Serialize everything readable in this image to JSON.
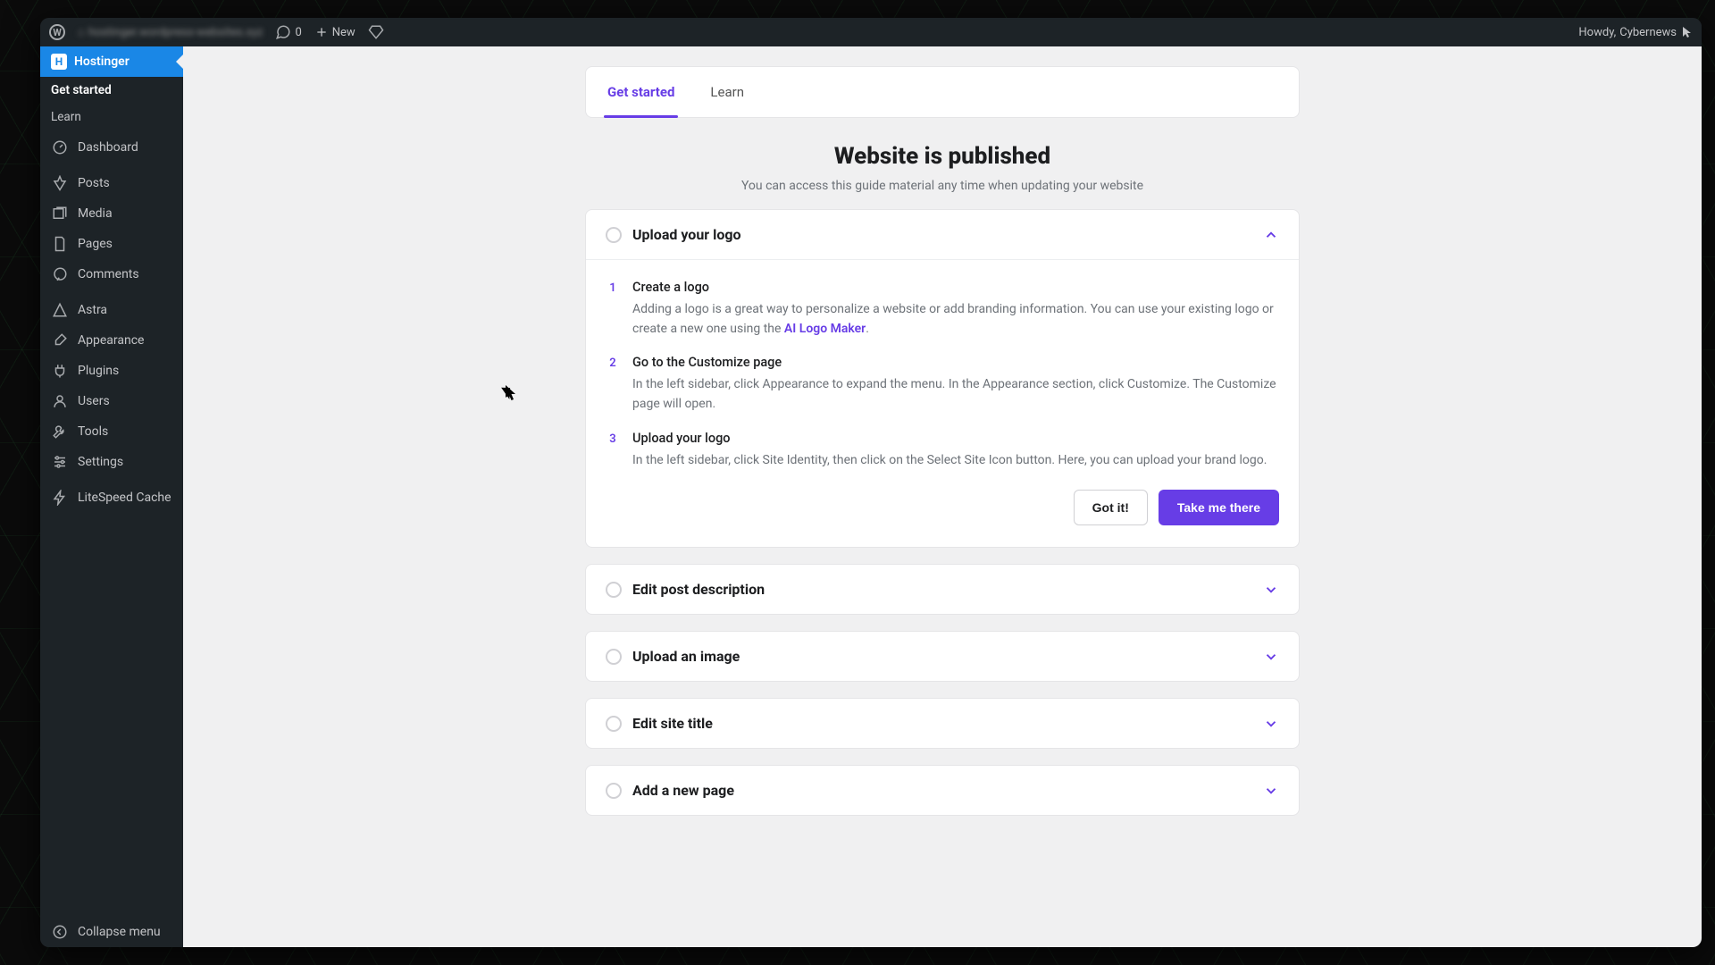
{
  "adminbar": {
    "site_name_blur": "hostinger.wordpress-websites.xyz",
    "comments_count": "0",
    "new_label": "New",
    "howdy_prefix": "Howdy, ",
    "user_name": "Cybernews"
  },
  "sidebar": {
    "brand_label": "Hostinger",
    "sub_items": [
      {
        "label": "Get started",
        "active": true
      },
      {
        "label": "Learn",
        "active": false
      }
    ],
    "items": [
      {
        "key": "dashboard",
        "label": "Dashboard",
        "icon": "gauge"
      },
      {
        "key": "posts",
        "label": "Posts",
        "icon": "pin"
      },
      {
        "key": "media",
        "label": "Media",
        "icon": "media"
      },
      {
        "key": "pages",
        "label": "Pages",
        "icon": "page"
      },
      {
        "key": "comments",
        "label": "Comments",
        "icon": "comment"
      },
      {
        "key": "astra",
        "label": "Astra",
        "icon": "astra"
      },
      {
        "key": "appearance",
        "label": "Appearance",
        "icon": "brush"
      },
      {
        "key": "plugins",
        "label": "Plugins",
        "icon": "plug"
      },
      {
        "key": "users",
        "label": "Users",
        "icon": "user"
      },
      {
        "key": "tools",
        "label": "Tools",
        "icon": "wrench"
      },
      {
        "key": "settings",
        "label": "Settings",
        "icon": "sliders"
      },
      {
        "key": "litespeed",
        "label": "LiteSpeed Cache",
        "icon": "bolt"
      }
    ],
    "collapse_label": "Collapse menu"
  },
  "tabs": [
    {
      "label": "Get started",
      "active": true
    },
    {
      "label": "Learn",
      "active": false
    }
  ],
  "headline": {
    "title": "Website is published",
    "subtitle": "You can access this guide material any time when updating your website"
  },
  "tasks": [
    {
      "title": "Upload your logo",
      "expanded": true,
      "steps": [
        {
          "num": "1",
          "title": "Create a logo",
          "desc_before": "Adding a logo is a great way to personalize a website or add branding information. You can use your existing logo or create a new one using the ",
          "link_text": "AI Logo Maker",
          "desc_after": "."
        },
        {
          "num": "2",
          "title": "Go to the Customize page",
          "desc": "In the left sidebar, click Appearance to expand the menu. In the Appearance section, click Customize. The Customize page will open."
        },
        {
          "num": "3",
          "title": "Upload your logo",
          "desc": "In the left sidebar, click Site Identity, then click on the Select Site Icon button. Here, you can upload your brand logo."
        }
      ],
      "got_it_label": "Got it!",
      "take_me_label": "Take me there"
    },
    {
      "title": "Edit post description",
      "expanded": false
    },
    {
      "title": "Upload an image",
      "expanded": false
    },
    {
      "title": "Edit site title",
      "expanded": false
    },
    {
      "title": "Add a new page",
      "expanded": false
    }
  ],
  "colors": {
    "accent": "#673de6",
    "brand_blue": "#1a87e6",
    "wp_dark": "#1d2327",
    "content_bg": "#f0f0f1"
  }
}
